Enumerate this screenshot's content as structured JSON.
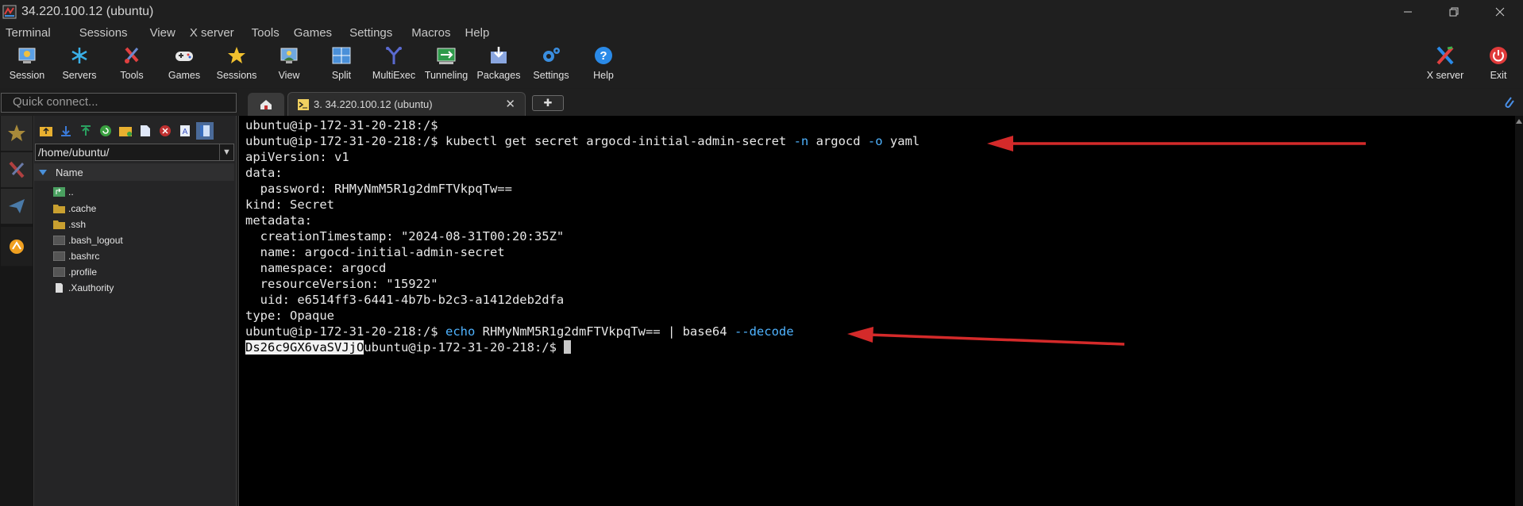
{
  "window": {
    "title": "34.220.100.12 (ubuntu)"
  },
  "menu": [
    "Terminal",
    "Sessions",
    "View",
    "X server",
    "Tools",
    "Games",
    "Settings",
    "Macros",
    "Help"
  ],
  "toolbar": {
    "session": "Session",
    "servers": "Servers",
    "tools": "Tools",
    "games": "Games",
    "sessions": "Sessions",
    "view": "View",
    "split": "Split",
    "multiexec": "MultiExec",
    "tunneling": "Tunneling",
    "packages": "Packages",
    "settings": "Settings",
    "help": "Help",
    "xserver": "X server",
    "exit": "Exit"
  },
  "quick_connect": {
    "placeholder": "Quick connect..."
  },
  "tab": {
    "label": "3. 34.220.100.12 (ubuntu)"
  },
  "sftp": {
    "path": "/home/ubuntu/",
    "column": "Name",
    "files": [
      "..",
      ".cache",
      ".ssh",
      ".bash_logout",
      ".bashrc",
      ".profile",
      ".Xauthority"
    ]
  },
  "terminal": {
    "prompt": "ubuntu@ip-172-31-20-218:/$",
    "cmd1_a": "kubectl get secret argocd-initial-admin-secret ",
    "cmd1_n": "-n",
    "cmd1_b": " argocd ",
    "cmd1_o": "-o",
    "cmd1_c": " yaml",
    "lines": [
      "apiVersion: v1",
      "data:",
      "  password: RHMyNmM5R1g2dmFTVkpqTw==",
      "kind: Secret",
      "metadata:",
      "  creationTimestamp: \"2024-08-31T00:20:35Z\"",
      "  name: argocd-initial-admin-secret",
      "  namespace: argocd",
      "  resourceVersion: \"15922\"",
      "  uid: e6514ff3-6441-4b7b-b2c3-a1412deb2dfa",
      "type: Opaque"
    ],
    "cmd2_echo": "echo",
    "cmd2_b": " RHMyNmM5R1g2dmFTVkpqTw== | base64 ",
    "cmd2_flag": "--decode",
    "decoded": "Ds26c9GX6vaSVJjO",
    "colors": {
      "flag": "#4fb3ff",
      "arrow": "#d42a2a"
    }
  }
}
